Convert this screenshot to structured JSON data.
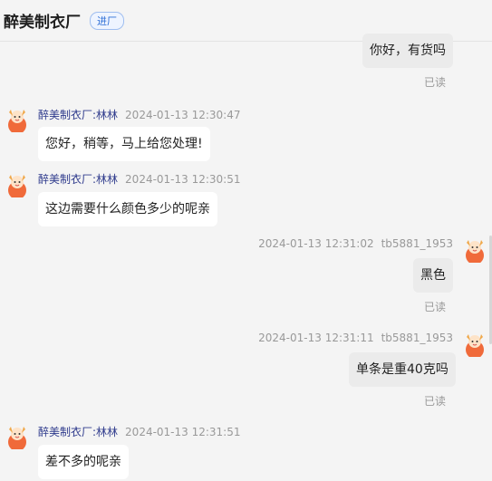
{
  "header": {
    "title": "醉美制衣厂",
    "badge": "进厂"
  },
  "messages": [
    {
      "side": "right",
      "text": "你好，有货吗",
      "status": "已读"
    },
    {
      "side": "left",
      "sender": "醉美制衣厂:林林",
      "time": "2024-01-13 12:30:47",
      "text": "您好，稍等，马上给您处理!"
    },
    {
      "side": "left",
      "sender": "醉美制衣厂:林林",
      "time": "2024-01-13 12:30:51",
      "text": "这边需要什么颜色多少的呢亲"
    },
    {
      "side": "right",
      "sender": "tb5881_1953",
      "time": "2024-01-13 12:31:02",
      "text": "黑色",
      "status": "已读"
    },
    {
      "side": "right",
      "sender": "tb5881_1953",
      "time": "2024-01-13 12:31:11",
      "text": "单条是重40克吗",
      "status": "已读"
    },
    {
      "side": "left",
      "sender": "醉美制衣厂:林林",
      "time": "2024-01-13 12:31:51",
      "text": "差不多的呢亲"
    }
  ],
  "icons": {
    "avatar": "cartoon-avatar-icon"
  }
}
